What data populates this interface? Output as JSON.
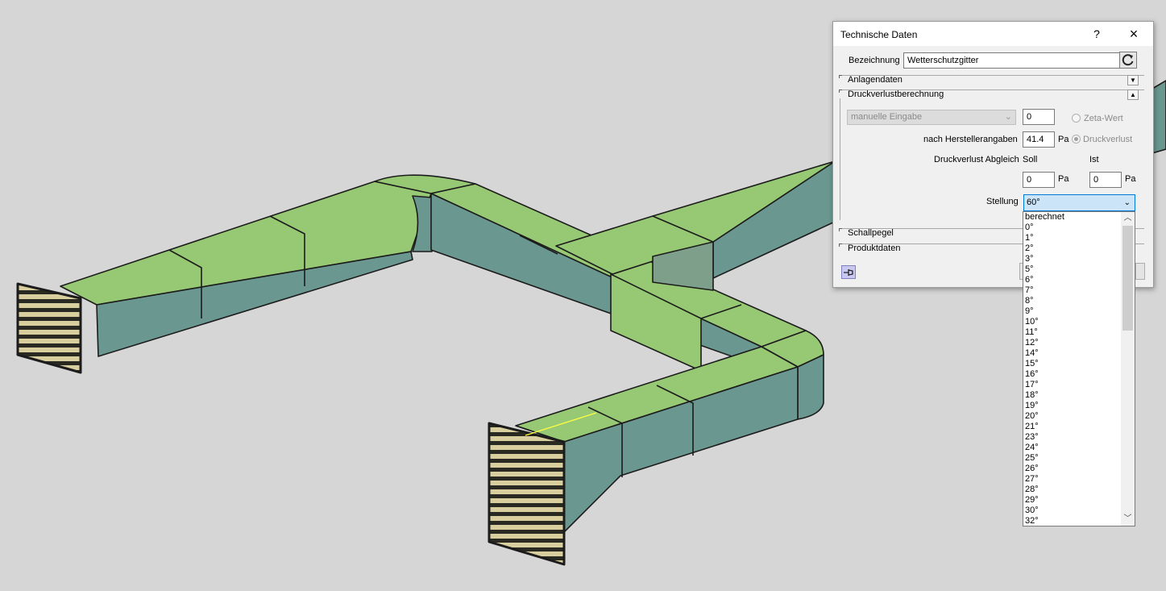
{
  "dialog": {
    "title": "Technische Daten",
    "help_label": "?",
    "close_label": "×",
    "bezeichnung_label": "Bezeichnung",
    "bezeichnung_value": "Wetterschutzgitter",
    "sections": {
      "anlagendaten": "Anlagendaten",
      "druckverlustberechnung": "Druckverlustberechnung",
      "schallpegel": "Schallpegel",
      "produktdaten": "Produktdaten"
    },
    "calc_method": "manuelle Eingabe",
    "zeta_value": "0",
    "zeta_label": "Zeta-Wert",
    "hersteller_label": "nach Herstellerangaben",
    "hersteller_value": "41.4",
    "unit_pa": "Pa",
    "druckverlust_label": "Druckverlust",
    "abgleich_label": "Druckverlust Abgleich",
    "soll_label": "Soll",
    "ist_label": "Ist",
    "soll_value": "0",
    "ist_value": "0",
    "stellung_label": "Stellung",
    "stellung_value": "60°"
  },
  "dropdown": {
    "items": [
      "berechnet",
      "0°",
      "1°",
      "2°",
      "3°",
      "5°",
      "6°",
      "7°",
      "8°",
      "9°",
      "10°",
      "11°",
      "12°",
      "14°",
      "15°",
      "16°",
      "17°",
      "18°",
      "19°",
      "20°",
      "21°",
      "23°",
      "24°",
      "25°",
      "26°",
      "27°",
      "28°",
      "29°",
      "30°",
      "32°"
    ]
  },
  "colors": {
    "duct_top": "#97c974",
    "duct_side": "#6b9791",
    "background": "#d6d6d6",
    "accent": "#0078d7"
  },
  "icons": {
    "refresh": "refresh-icon",
    "pin": "pin-icon",
    "expand": "chevron-down-icon",
    "collapse": "chevron-up-icon"
  }
}
